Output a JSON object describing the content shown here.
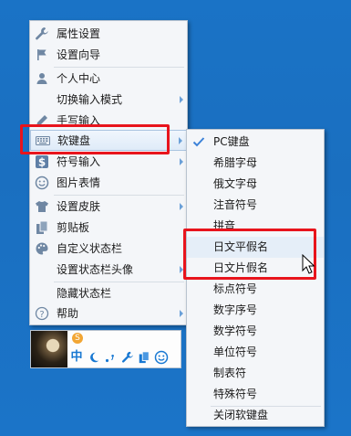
{
  "main_menu": {
    "items": [
      {
        "label": "属性设置",
        "icon": "wrench-icon"
      },
      {
        "label": "设置向导",
        "icon": "flag-icon"
      },
      {
        "label": "个人中心",
        "icon": "person-icon"
      },
      {
        "label": "切换输入模式",
        "icon": "",
        "has_submenu": true
      },
      {
        "label": "手写输入",
        "icon": "pen-icon"
      },
      {
        "label": "软键盘",
        "icon": "keyboard-icon",
        "has_submenu": true
      },
      {
        "label": "符号输入",
        "icon": "dollar-icon",
        "has_submenu": true
      },
      {
        "label": "图片表情",
        "icon": "smiley-icon"
      },
      {
        "label": "设置皮肤",
        "icon": "shirt-icon",
        "has_submenu": true
      },
      {
        "label": "剪贴板",
        "icon": "clipboard-icon"
      },
      {
        "label": "自定义状态栏",
        "icon": "palette-icon"
      },
      {
        "label": "设置状态栏头像",
        "icon": "",
        "has_submenu": true
      },
      {
        "label": "隐藏状态栏",
        "icon": ""
      },
      {
        "label": "帮助",
        "icon": "help-icon",
        "has_submenu": true
      }
    ]
  },
  "soft_keyboard_menu": {
    "items": [
      {
        "label": "PC键盘",
        "checked": true
      },
      {
        "label": "希腊字母"
      },
      {
        "label": "俄文字母"
      },
      {
        "label": "注音符号"
      },
      {
        "label": "拼音"
      },
      {
        "label": "日文平假名"
      },
      {
        "label": "日文片假名"
      },
      {
        "label": "标点符号"
      },
      {
        "label": "数字序号"
      },
      {
        "label": "数学符号"
      },
      {
        "label": "单位符号"
      },
      {
        "label": "制表符"
      },
      {
        "label": "特殊符号"
      },
      {
        "label": "关闭软键盘"
      }
    ]
  },
  "status_bar": {
    "mode": "中",
    "badge": "S",
    "icons": [
      "moon-icon",
      "punctuation-icon",
      "wrench-icon",
      "clipboard-icon",
      "smiley-icon"
    ]
  },
  "colors": {
    "accent": "#1878d2",
    "highlight_box": "#e8141c",
    "desktop": "#1a73c6"
  }
}
